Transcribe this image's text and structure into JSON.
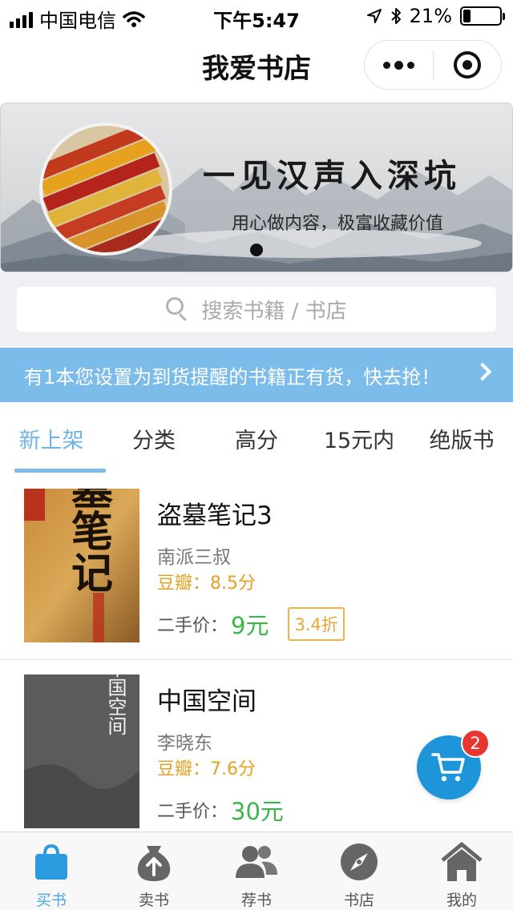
{
  "status_bar": {
    "carrier": "中国电信",
    "time": "下午5:47",
    "battery": "21%",
    "battery_level": 0.21
  },
  "nav": {
    "title": "我爱书店"
  },
  "banner": {
    "headline": "一见汉声入深坑",
    "subtitle": "用心做内容，极富收藏价值",
    "page_count": 1,
    "active_page": 1
  },
  "search": {
    "placeholder": "搜索书籍 / 书店"
  },
  "notice": {
    "text": "有1本您设置为到货提醒的书籍正有货，快去抢！"
  },
  "tabs": [
    {
      "label": "新上架",
      "active": true
    },
    {
      "label": "分类",
      "active": false
    },
    {
      "label": "高分",
      "active": false
    },
    {
      "label": "15元内",
      "active": false
    },
    {
      "label": "绝版书",
      "active": false
    }
  ],
  "books": [
    {
      "title": "盗墓笔记3",
      "author": "南派三叔",
      "rating": "豆瓣：8.5分",
      "price_label": "二手价：",
      "price": "9元",
      "discount": "3.4折",
      "cover_text": "盗墓笔记"
    },
    {
      "title": "中国空间",
      "author": "李晓东",
      "rating": "豆瓣：7.6分",
      "price_label": "二手价：",
      "price": "30元",
      "discount": "",
      "cover_text": "中国空间"
    }
  ],
  "cart": {
    "badge": "2"
  },
  "tab_bar": [
    {
      "label": "买书",
      "icon": "shopping-bag-icon",
      "active": true
    },
    {
      "label": "卖书",
      "icon": "money-bag-icon",
      "active": false
    },
    {
      "label": "荐书",
      "icon": "people-icon",
      "active": false
    },
    {
      "label": "书店",
      "icon": "compass-icon",
      "active": false
    },
    {
      "label": "我的",
      "icon": "home-icon",
      "active": false
    }
  ],
  "colors": {
    "accent": "#7cbcea",
    "price_green": "#3cb64b",
    "rating_orange": "#e4a021",
    "cart_blue": "#1e95d8",
    "badge_red": "#e8352f"
  }
}
